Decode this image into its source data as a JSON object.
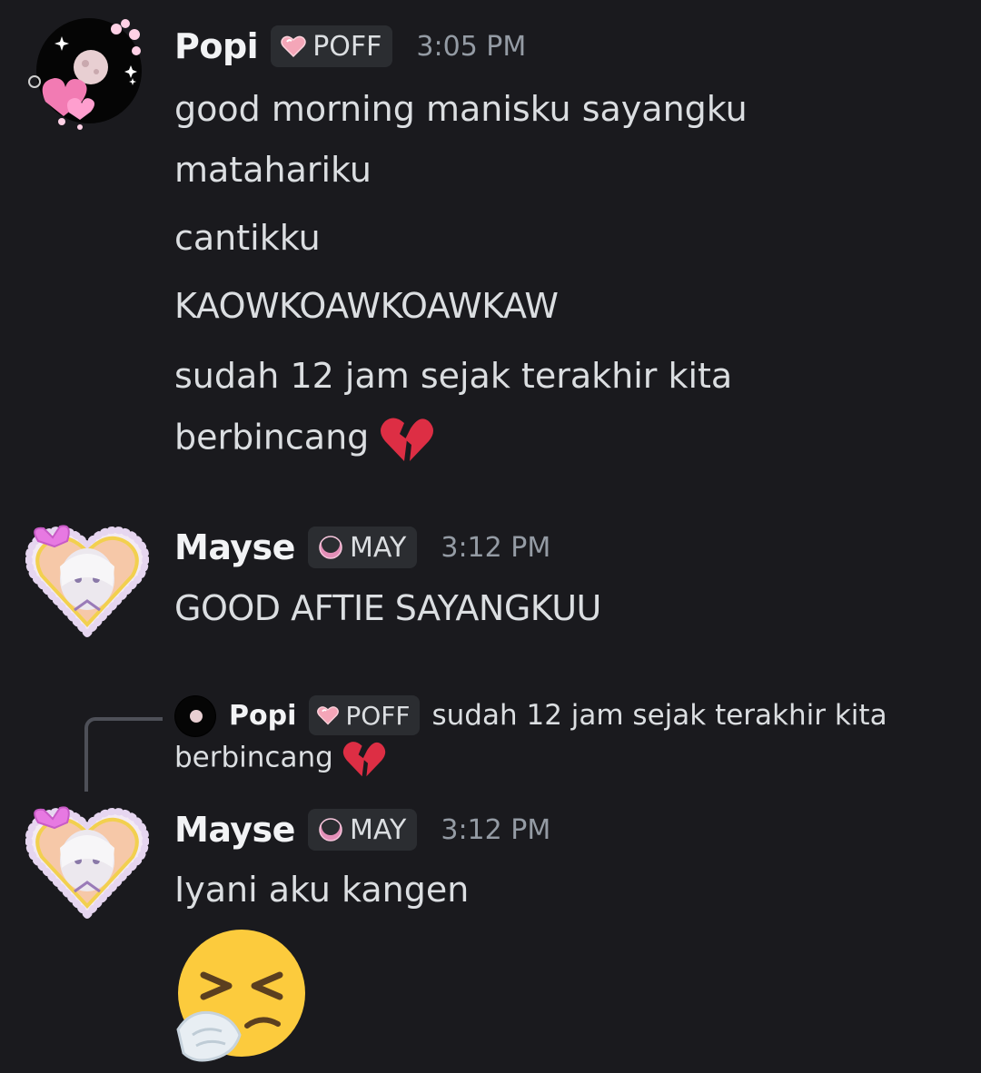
{
  "messages": [
    {
      "author": "Popi",
      "tag": "POFF",
      "time": "3:05 PM",
      "lines": [
        "good morning manisku sayangku",
        "matahariku",
        "cantikku",
        "KAOWKOAWKOAWKAW",
        "sudah 12 jam sejak terakhir kita",
        "berbincang"
      ],
      "emoji": "broken-heart"
    },
    {
      "author": "Mayse",
      "tag": "MAY",
      "time": "3:12 PM",
      "lines": [
        "GOOD AFTIE SAYANGKUU"
      ]
    },
    {
      "reply_to": {
        "author": "Popi",
        "tag": "POFF",
        "text_line1": "sudah 12 jam sejak terakhir kita",
        "text_line2": "berbincang"
      },
      "author": "Mayse",
      "tag": "MAY",
      "time": "3:12 PM",
      "lines": [
        "Iyani aku kangen"
      ],
      "big_emoji": "sneezing-face"
    }
  ],
  "colors": {
    "background": "#1a1a1e",
    "tag_bg": "#2b2d31",
    "timestamp": "#949ba4",
    "reply_spine": "#4e5058",
    "broken_heart": "#dd2e44",
    "tag_pink": "#f4a6b8"
  }
}
